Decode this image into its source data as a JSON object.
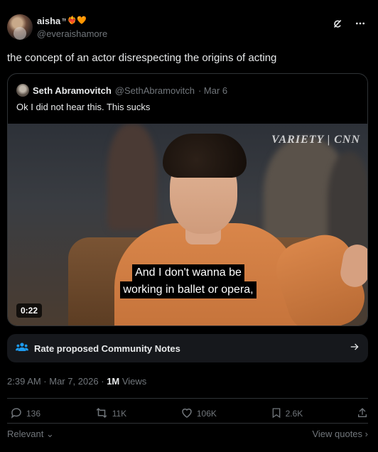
{
  "author": {
    "display_name": "aisha",
    "superscript": "ᵀᶠ",
    "emojis": "❤️‍🔥🧡",
    "handle": "@everaishamore"
  },
  "tweet": {
    "text": "the concept of an actor disrespecting the origins of acting"
  },
  "quote": {
    "name": "Seth Abramovitch",
    "handle": "@SethAbramovitch",
    "date": "· Mar 6",
    "text": "Ok I did not hear this. This sucks",
    "video": {
      "watermark": "VARIETY | CNN",
      "caption_line1": "And I don't wanna be",
      "caption_line2": "working in ballet or opera,",
      "duration": "0:22"
    }
  },
  "community_notes": {
    "label": "Rate proposed Community Notes"
  },
  "meta": {
    "time": "2:39 AM · Mar 7, 2026 · ",
    "views_count": "1M",
    "views_label": " Views"
  },
  "actions": {
    "replies": "136",
    "reposts": "11K",
    "likes": "106K",
    "bookmarks": "2.6K"
  },
  "footer": {
    "sort": "Relevant",
    "quotes_link": "View quotes"
  }
}
